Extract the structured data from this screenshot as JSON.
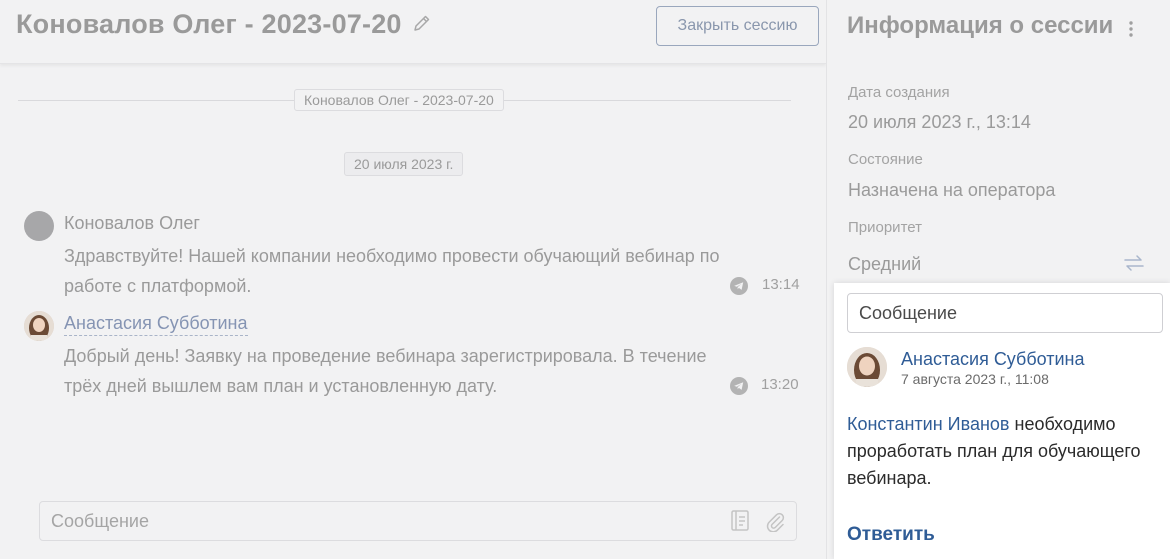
{
  "chat": {
    "title": "Коновалов Олег - 2023-07-20",
    "close_button": "Закрыть сессию",
    "session_separator": "Коновалов Олег - 2023-07-20",
    "date_chip": "20 июля 2023 г.",
    "messages": [
      {
        "author": "Коновалов Олег",
        "text": "Здравствуйте! Нашей компании необходимо провести обучающий вебинар по работе с платформой.",
        "time": "13:14",
        "channel_icon": "telegram-icon"
      },
      {
        "author": "Анастасия Субботина",
        "text": "Добрый день! Заявку на проведение вебинара зарегистрировала. В течение трёх дней вышлем вам план и установленную дату.",
        "time": "13:20",
        "channel_icon": "telegram-icon"
      }
    ],
    "composer": {
      "placeholder": "Сообщение",
      "icons": [
        "template-icon",
        "paperclip-icon"
      ]
    }
  },
  "session_info": {
    "title": "Информация о сессии",
    "fields": [
      {
        "label": "Дата создания",
        "value": "20 июля 2023 г., 13:14"
      },
      {
        "label": "Состояние",
        "value": "Назначена на оператора"
      },
      {
        "label": "Приоритет",
        "value": "Средний"
      }
    ]
  },
  "note_card": {
    "input_placeholder": "Сообщение",
    "author": "Анастасия Субботина",
    "date": "7 августа 2023 г., 11:08",
    "mention": "Константин Иванов",
    "text": " необходимо проработать план для обучающего вебинара.",
    "reply_label": "Ответить"
  },
  "colors": {
    "accent": "#2f5c96",
    "muted_text": "#9a9a9a",
    "background": "#f2f2f3"
  }
}
